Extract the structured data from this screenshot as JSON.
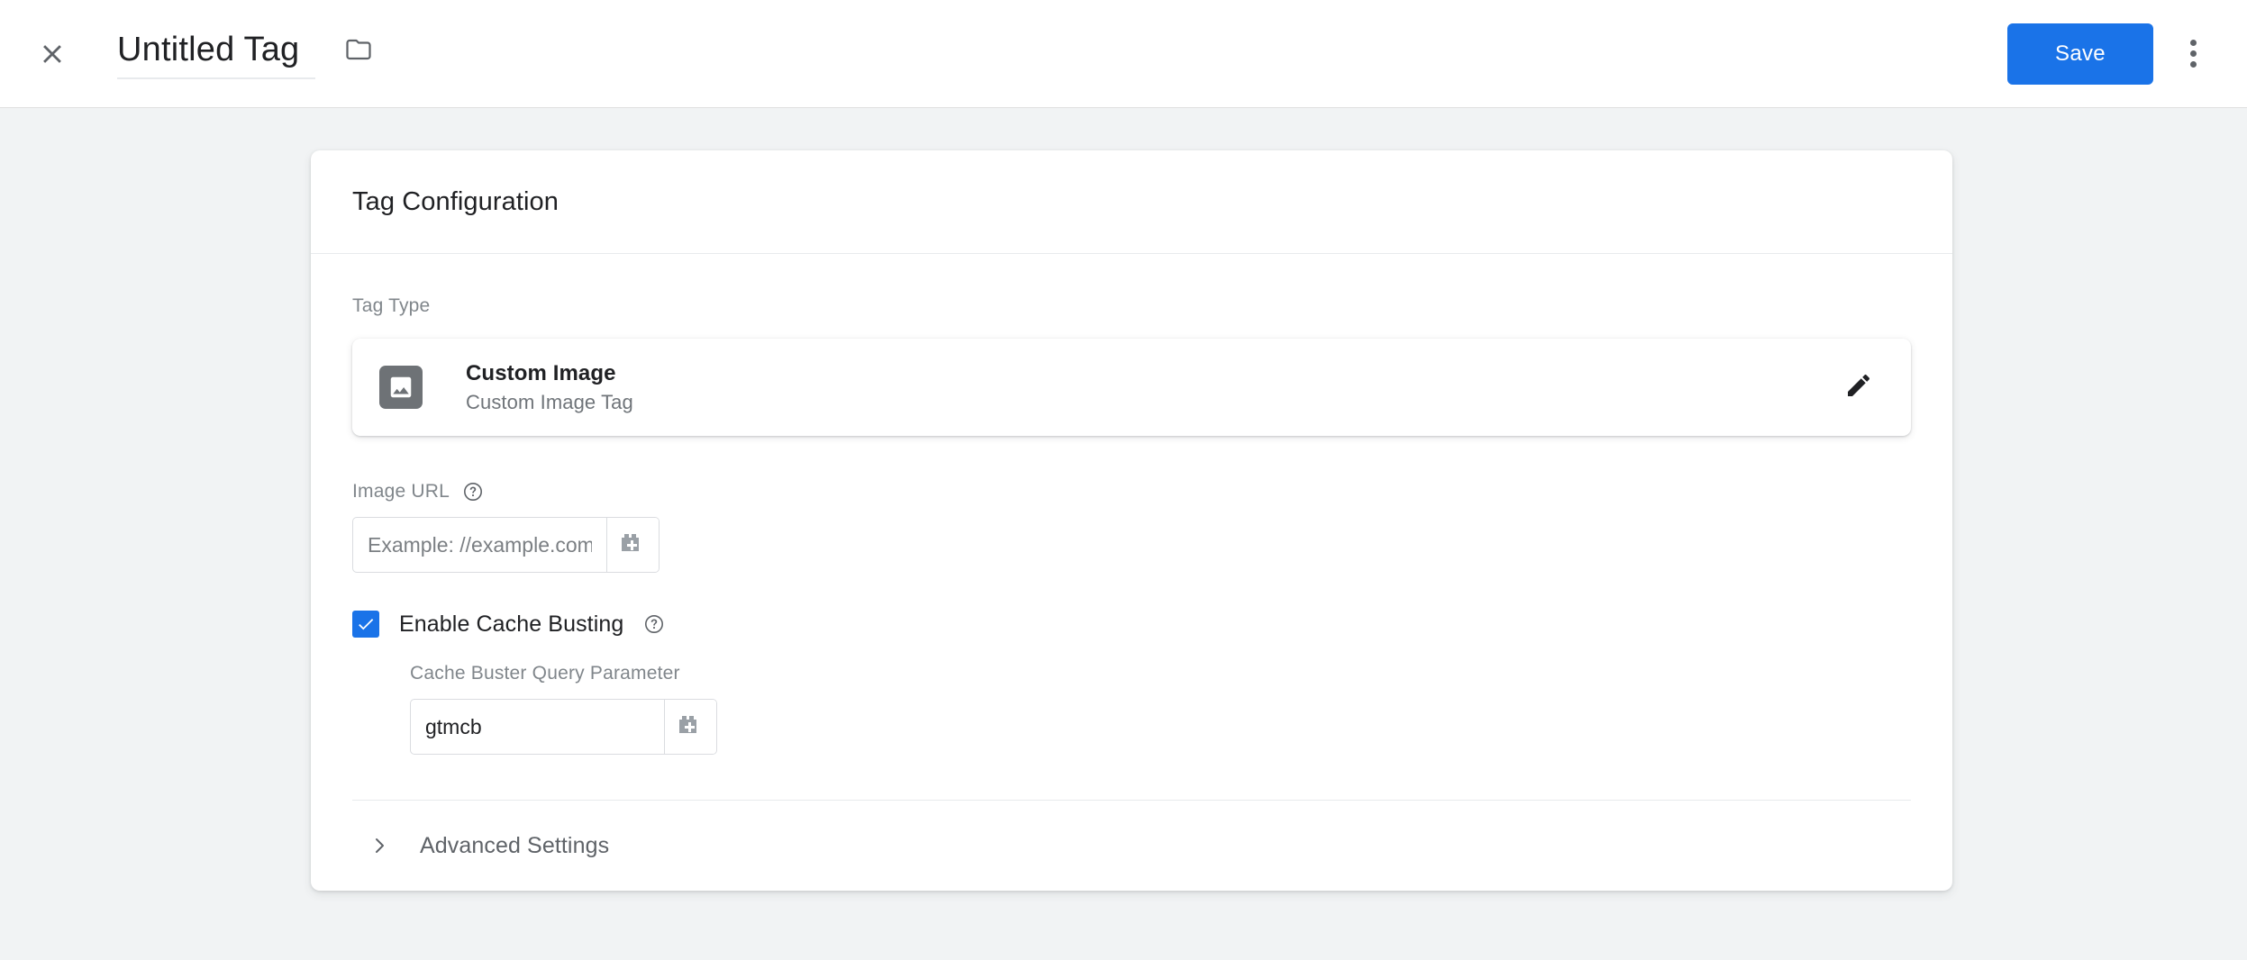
{
  "header": {
    "close_icon": "close-icon",
    "title_value": "Untitled Tag",
    "title_placeholder": "Untitled Tag",
    "folder_icon": "folder-icon",
    "save_label": "Save",
    "overflow_icon": "more-vert-icon",
    "accent_color": "#1a73e8"
  },
  "card": {
    "title": "Tag Configuration",
    "tag_type": {
      "label": "Tag Type",
      "icon": "image-icon",
      "name": "Custom Image",
      "description": "Custom Image Tag",
      "edit_icon": "pencil-icon"
    },
    "image_url": {
      "label": "Image URL",
      "help_icon": "help-circle-icon",
      "value": "",
      "placeholder": "Example: //example.com/a.gif",
      "variable_picker_icon": "variable-block-plus-icon"
    },
    "cache_busting": {
      "checked": true,
      "label": "Enable Cache Busting",
      "help_icon": "help-circle-icon",
      "query_param_label": "Cache Buster Query Parameter",
      "query_param_value": "gtmcb",
      "query_param_placeholder": "",
      "variable_picker_icon": "variable-block-plus-icon"
    },
    "advanced": {
      "chevron_icon": "chevron-right-icon",
      "label": "Advanced Settings"
    }
  }
}
